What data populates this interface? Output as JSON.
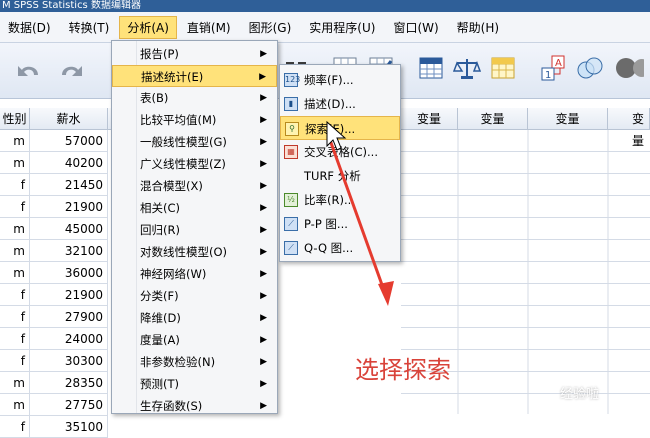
{
  "window": {
    "title": "M SPSS Statistics 数据编辑器"
  },
  "menubar": [
    {
      "label": "数据(D)"
    },
    {
      "label": "转换(T)"
    },
    {
      "label": "分析(A)"
    },
    {
      "label": "直销(M)"
    },
    {
      "label": "图形(G)"
    },
    {
      "label": "实用程序(U)"
    },
    {
      "label": "窗口(W)"
    },
    {
      "label": "帮助(H)"
    }
  ],
  "grid": {
    "headers": [
      "性别",
      "薪水",
      "变量",
      "变量",
      "变量",
      "变量"
    ],
    "rows": [
      [
        "m",
        "57000"
      ],
      [
        "m",
        "40200"
      ],
      [
        "f",
        "21450"
      ],
      [
        "f",
        "21900"
      ],
      [
        "m",
        "45000"
      ],
      [
        "m",
        "32100"
      ],
      [
        "m",
        "36000"
      ],
      [
        "f",
        "21900"
      ],
      [
        "f",
        "27900"
      ],
      [
        "f",
        "24000"
      ],
      [
        "f",
        "30300"
      ],
      [
        "m",
        "28350"
      ],
      [
        "m",
        "27750"
      ],
      [
        "f",
        "35100"
      ]
    ],
    "right_headers": [
      "变量",
      "变量",
      "变量",
      "变量"
    ],
    "last_header": "变量"
  },
  "analyze_menu": [
    {
      "label": "报告(P)"
    },
    {
      "label": "描述统计(E)"
    },
    {
      "label": "表(B)"
    },
    {
      "label": "比较平均值(M)"
    },
    {
      "label": "一般线性模型(G)"
    },
    {
      "label": "广义线性模型(Z)"
    },
    {
      "label": "混合模型(X)"
    },
    {
      "label": "相关(C)"
    },
    {
      "label": "回归(R)"
    },
    {
      "label": "对数线性模型(O)"
    },
    {
      "label": "神经网络(W)"
    },
    {
      "label": "分类(F)"
    },
    {
      "label": "降维(D)"
    },
    {
      "label": "度量(A)"
    },
    {
      "label": "非参数检验(N)"
    },
    {
      "label": "预测(T)"
    },
    {
      "label": "生存函数(S)"
    }
  ],
  "descriptive_submenu": [
    {
      "label": "频率(F)...",
      "icon": "frequency-icon"
    },
    {
      "label": "描述(D)...",
      "icon": "descriptives-icon"
    },
    {
      "label": "探索(E)...",
      "icon": "explore-icon"
    },
    {
      "label": "交叉表格(C)...",
      "icon": "crosstabs-icon"
    },
    {
      "label": "TURF 分析",
      "icon": ""
    },
    {
      "label": "比率(R)...",
      "icon": "ratio-icon"
    },
    {
      "label": "P-P 图...",
      "icon": "pp-plot-icon"
    },
    {
      "label": "Q-Q 图...",
      "icon": "qq-plot-icon"
    }
  ],
  "annotation": {
    "text": "选择探索"
  },
  "watermark": {
    "text": "经验啦"
  }
}
